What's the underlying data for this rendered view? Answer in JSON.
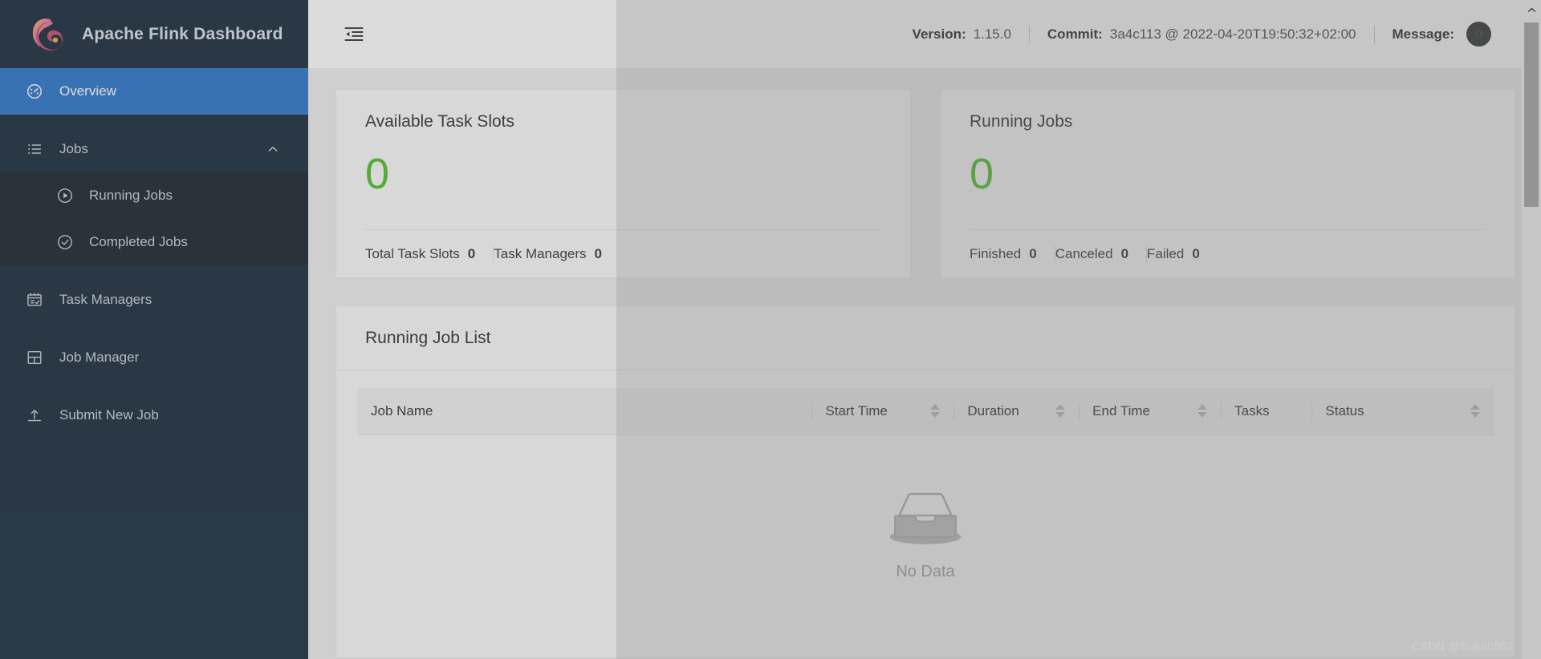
{
  "brand": {
    "title": "Apache Flink Dashboard",
    "logo_icon": "flink-squirrel-logo"
  },
  "sidebar": {
    "items": [
      {
        "label": "Overview",
        "icon": "dashboard-icon",
        "active": true
      },
      {
        "label": "Jobs",
        "icon": "list-icon",
        "expanded": true,
        "caret_icon": "chevron-up-icon"
      },
      {
        "label": "Running Jobs",
        "icon": "play-circle-icon"
      },
      {
        "label": "Completed Jobs",
        "icon": "check-circle-icon"
      },
      {
        "label": "Task Managers",
        "icon": "calendar-check-icon"
      },
      {
        "label": "Job Manager",
        "icon": "block-grid-icon"
      },
      {
        "label": "Submit New Job",
        "icon": "upload-icon"
      }
    ]
  },
  "topbar": {
    "fold_icon": "menu-fold-icon",
    "version_label": "Version:",
    "version_value": "1.15.0",
    "commit_label": "Commit:",
    "commit_value": "3a4c113 @ 2022-04-20T19:50:32+02:00",
    "message_label": "Message:",
    "message_count": "0"
  },
  "cards": [
    {
      "title": "Available Task Slots",
      "value": "0",
      "value_color": "#3eb914",
      "stats": [
        {
          "label": "Total Task Slots",
          "value": "0"
        },
        {
          "label": "Task Managers",
          "value": "0"
        }
      ]
    },
    {
      "title": "Running Jobs",
      "value": "0",
      "value_color": "#3eb914",
      "stats": [
        {
          "label": "Finished",
          "value": "0"
        },
        {
          "label": "Canceled",
          "value": "0"
        },
        {
          "label": "Failed",
          "value": "0"
        }
      ]
    }
  ],
  "panel": {
    "title": "Running Job List",
    "columns": [
      {
        "label": "Job Name",
        "sortable": false,
        "divider": false,
        "width": "40%"
      },
      {
        "label": "Start Time",
        "sortable": true,
        "divider": true,
        "width": "12%"
      },
      {
        "label": "Duration",
        "sortable": true,
        "divider": true,
        "width": "11%"
      },
      {
        "label": "End Time",
        "sortable": true,
        "divider": true,
        "width": "12%"
      },
      {
        "label": "Tasks",
        "sortable": false,
        "divider": true,
        "width": "8%"
      },
      {
        "label": "Status",
        "sortable": true,
        "divider": true,
        "width": "12%"
      }
    ],
    "rows": [],
    "empty_text": "No Data",
    "empty_icon": "inbox-empty-icon"
  },
  "scrollbar": {
    "up_arrow_icon": "chevron-up-icon"
  },
  "watermark": "CSDN @Bulut0907"
}
